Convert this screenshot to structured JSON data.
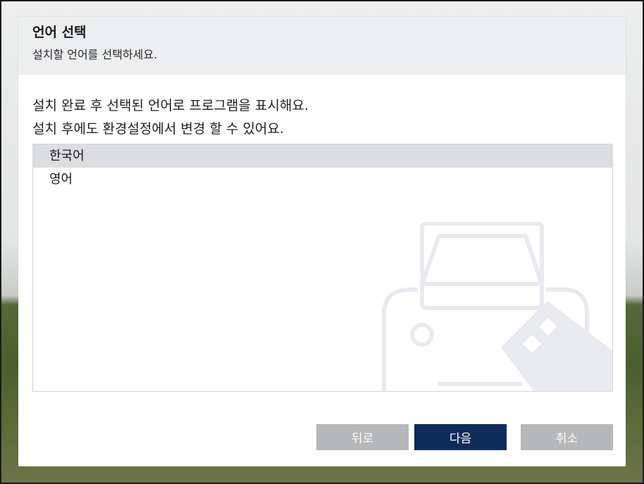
{
  "dialog": {
    "title": "언어 선택",
    "subtitle": "설치할 언어를 선택하세요.",
    "description_line1": "설치 완료 후 선택된 언어로 프로그램을 표시해요.",
    "description_line2": "설치 후에도 환경설정에서 변경 할 수 있어요."
  },
  "languages": [
    {
      "label": "한국어",
      "selected": true
    },
    {
      "label": "영어",
      "selected": false
    }
  ],
  "buttons": {
    "back": "뒤로",
    "next": "다음",
    "cancel": "취소"
  },
  "colors": {
    "primary": "#0f2c5a",
    "disabled": "#b6b7b9",
    "selected_row": "#dcdde0",
    "header_bg": "#eceef0"
  },
  "icons": {
    "watermark": "car-watermark-icon"
  }
}
